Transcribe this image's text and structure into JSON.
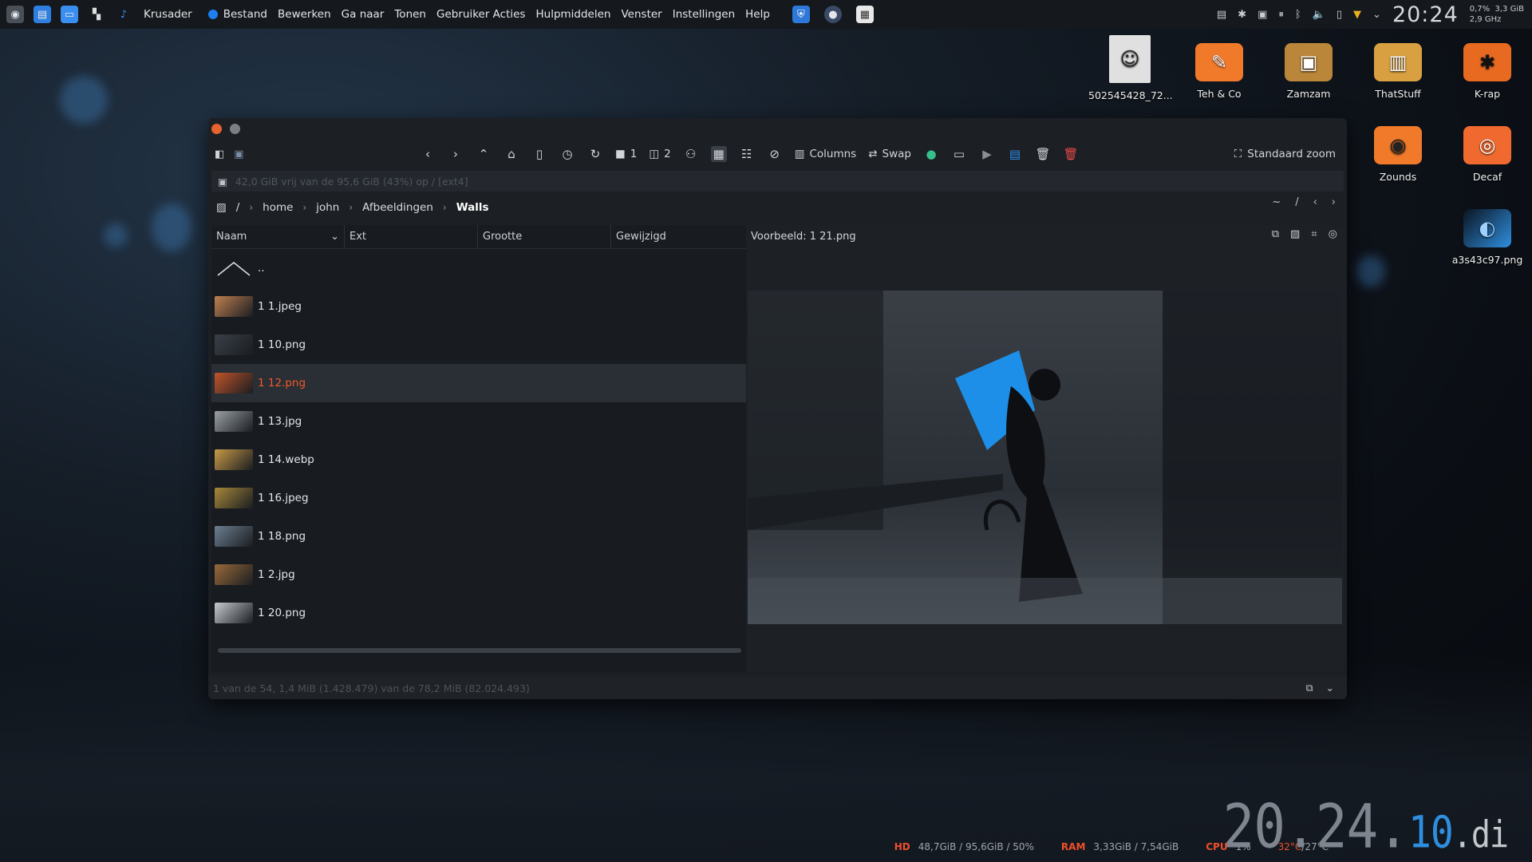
{
  "topbar": {
    "app_name": "Krusader",
    "menu": [
      "Bestand",
      "Bewerken",
      "Ga naar",
      "Tonen",
      "Gebruiker Acties",
      "Hulpmiddelen",
      "Venster",
      "Instellingen",
      "Help"
    ],
    "clock": "20:24",
    "cpu_mini": "0,7%",
    "freq_mini": "2,9 GHz",
    "mem_mini": "3,3 GiB"
  },
  "desktop_icons": [
    {
      "label": "502545428_72...",
      "icon": "image-thumb-icon",
      "color": "#d8d8d8"
    },
    {
      "label": "Teh & Co",
      "icon": "app-icon",
      "color": "#f0792a"
    },
    {
      "label": "Zamzam",
      "icon": "app-icon",
      "color": "#b9863a"
    },
    {
      "label": "ThatStuff",
      "icon": "app-icon",
      "color": "#d8a040"
    },
    {
      "label": "K-rap",
      "icon": "app-icon",
      "color": "#e86a20"
    },
    {
      "label": "Zounds",
      "icon": "app-icon",
      "color": "#f07a2a"
    },
    {
      "label": "Decaf",
      "icon": "app-icon",
      "color": "#f06a30"
    },
    {
      "label": "a3s43c97.png",
      "icon": "image-icon",
      "color": "#2f8fe0"
    }
  ],
  "window": {
    "toolbar": {
      "panel1_label": "1",
      "panel2_label": "2",
      "columns_label": "Columns",
      "swap_label": "Swap",
      "zoom_label": "Standaard zoom"
    },
    "free_space": "42,0 GiB vrij van de 95,6 GiB (43%) op / [ext4]",
    "breadcrumb": [
      "/",
      "home",
      "john",
      "Afbeeldingen",
      "Walls"
    ],
    "crumb_right": [
      "~",
      "/"
    ],
    "columns": [
      "Naam",
      "Ext",
      "Grootte",
      "Gewijzigd"
    ],
    "parent_label": "..",
    "files": [
      {
        "name": "1 1.jpeg",
        "thumb": "#c08050"
      },
      {
        "name": "1 10.png",
        "thumb": "#3a4048"
      },
      {
        "name": "1 12.png",
        "thumb": "#c0542a",
        "selected": true
      },
      {
        "name": "1 13.jpg",
        "thumb": "#9aa0a6"
      },
      {
        "name": "1 14.webp",
        "thumb": "#c89a48"
      },
      {
        "name": "1 16.jpeg",
        "thumb": "#a8883a"
      },
      {
        "name": "1 18.png",
        "thumb": "#6c7e90"
      },
      {
        "name": "1 2.jpg",
        "thumb": "#9a6a3a"
      },
      {
        "name": "1 20.png",
        "thumb": "#c7ccd2"
      }
    ],
    "preview_label": "Voorbeeld: 1 21.png",
    "status": "1 van de 54, 1,4 MiB (1.428.479) van de 78,2 MiB (82.024.493)"
  },
  "sysinfo": {
    "hd_key": "HD",
    "hd_val": "48,7GiB / 95,6GiB / 50%",
    "ram_key": "RAM",
    "ram_val": "3,33GiB / 7,54GiB",
    "cpu_key": "CPU",
    "cpu_val": "1%",
    "temp_a": "32°C",
    "temp_b": "27°C"
  },
  "bigclock": {
    "main": "20.24.",
    "accent": "10",
    "suffix": ".di"
  }
}
